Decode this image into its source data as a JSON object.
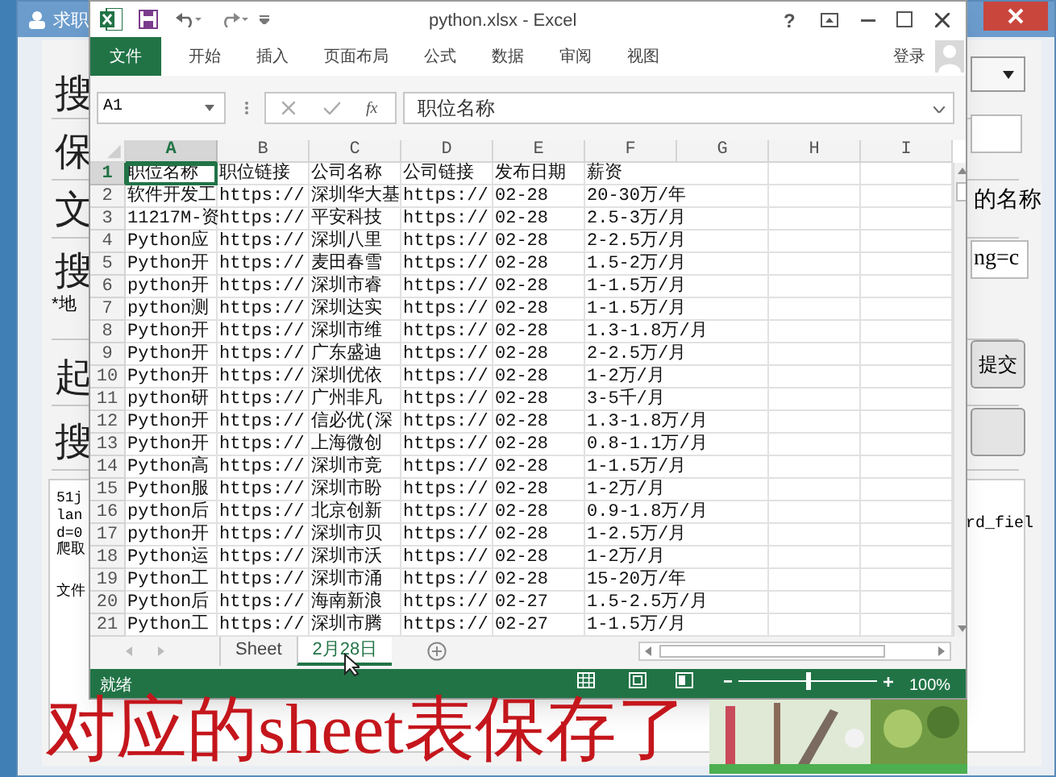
{
  "background_window": {
    "title": "求职",
    "labels": [
      "搜",
      "保",
      "文",
      "搜",
      "起",
      "搜"
    ],
    "note": "*地",
    "name_fragment": "的名称",
    "url_field": {
      "value": "ng=c"
    },
    "submit_button": "提交",
    "log_left": [
      "51j",
      "lan",
      "d=0",
      "爬取",
      "文件"
    ],
    "log_right": "rd_fiel"
  },
  "excel": {
    "title": "python.xlsx - Excel",
    "help": "?",
    "ribbon_tabs": [
      {
        "label": "文件",
        "kind": "file"
      },
      {
        "label": "开始",
        "kind": "tab"
      },
      {
        "label": "插入",
        "kind": "tab"
      },
      {
        "label": "页面布局",
        "kind": "tab"
      },
      {
        "label": "公式",
        "kind": "tab"
      },
      {
        "label": "数据",
        "kind": "tab"
      },
      {
        "label": "审阅",
        "kind": "tab"
      },
      {
        "label": "视图",
        "kind": "tab"
      }
    ],
    "sign_in": "登录",
    "name_box": "A1",
    "function_label": "fx",
    "formula": "职位名称",
    "columns": [
      {
        "label": "A",
        "selected": true
      },
      {
        "label": "B",
        "selected": false
      },
      {
        "label": "C",
        "selected": false
      },
      {
        "label": "D",
        "selected": false
      },
      {
        "label": "E",
        "selected": false
      },
      {
        "label": "F",
        "selected": false
      },
      {
        "label": "G",
        "selected": false
      },
      {
        "label": "H",
        "selected": false
      },
      {
        "label": "I",
        "selected": false
      }
    ],
    "rows": [
      {
        "number": "1",
        "selected": true,
        "cells": [
          "职位名称",
          "职位链接",
          "公司名称",
          "公司链接",
          "发布日期",
          "薪资"
        ]
      },
      {
        "number": "2",
        "selected": false,
        "cells": [
          "软件开发工",
          "https://",
          "深圳华大基",
          "https://",
          "02-28",
          "20-30万/年"
        ]
      },
      {
        "number": "3",
        "selected": false,
        "cells": [
          "11217M-资",
          "https://",
          "平安科技",
          "https://",
          "02-28",
          "2.5-3万/月"
        ]
      },
      {
        "number": "4",
        "selected": false,
        "cells": [
          "Python应",
          "https://",
          "深圳八里",
          "https://",
          "02-28",
          "2-2.5万/月"
        ]
      },
      {
        "number": "5",
        "selected": false,
        "cells": [
          "Python开",
          "https://",
          "麦田春雪",
          "https://",
          "02-28",
          "1.5-2万/月"
        ]
      },
      {
        "number": "6",
        "selected": false,
        "cells": [
          "python开",
          "https://",
          "深圳市睿",
          "https://",
          "02-28",
          "1-1.5万/月"
        ]
      },
      {
        "number": "7",
        "selected": false,
        "cells": [
          "python测",
          "https://",
          "深圳达实",
          "https://",
          "02-28",
          "1-1.5万/月"
        ]
      },
      {
        "number": "8",
        "selected": false,
        "cells": [
          "Python开",
          "https://",
          "深圳市维",
          "https://",
          "02-28",
          "1.3-1.8万/月"
        ]
      },
      {
        "number": "9",
        "selected": false,
        "cells": [
          "Python开",
          "https://",
          "广东盛迪",
          "https://",
          "02-28",
          "2-2.5万/月"
        ]
      },
      {
        "number": "10",
        "selected": false,
        "cells": [
          "Python开",
          "https://",
          "深圳优依",
          "https://",
          "02-28",
          "1-2万/月"
        ]
      },
      {
        "number": "11",
        "selected": false,
        "cells": [
          "python研",
          "https://",
          "广州非凡",
          "https://",
          "02-28",
          "3-5千/月"
        ]
      },
      {
        "number": "12",
        "selected": false,
        "cells": [
          "Python开",
          "https://",
          "信必优(深",
          "https://",
          "02-28",
          "1.3-1.8万/月"
        ]
      },
      {
        "number": "13",
        "selected": false,
        "cells": [
          "Python开",
          "https://",
          "上海微创",
          "https://",
          "02-28",
          "0.8-1.1万/月"
        ]
      },
      {
        "number": "14",
        "selected": false,
        "cells": [
          "Python高",
          "https://",
          "深圳市竞",
          "https://",
          "02-28",
          "1-1.5万/月"
        ]
      },
      {
        "number": "15",
        "selected": false,
        "cells": [
          "Python服",
          "https://",
          "深圳市盼",
          "https://",
          "02-28",
          "1-2万/月"
        ]
      },
      {
        "number": "16",
        "selected": false,
        "cells": [
          "python后",
          "https://",
          "北京创新",
          "https://",
          "02-28",
          "0.9-1.8万/月"
        ]
      },
      {
        "number": "17",
        "selected": false,
        "cells": [
          "python开",
          "https://",
          "深圳市贝",
          "https://",
          "02-28",
          "1-2.5万/月"
        ]
      },
      {
        "number": "18",
        "selected": false,
        "cells": [
          "Python运",
          "https://",
          "深圳市沃",
          "https://",
          "02-28",
          "1-2万/月"
        ]
      },
      {
        "number": "19",
        "selected": false,
        "cells": [
          "Python工",
          "https://",
          "深圳市涌",
          "https://",
          "02-28",
          "15-20万/年"
        ]
      },
      {
        "number": "20",
        "selected": false,
        "cells": [
          "Python后",
          "https://",
          "海南新浪",
          "https://",
          "02-27",
          "1.5-2.5万/月"
        ]
      },
      {
        "number": "21",
        "selected": false,
        "cells": [
          "Python工",
          "https://",
          "深圳市腾",
          "https://",
          "02-27",
          "1-1.5万/月"
        ]
      }
    ],
    "sheet_tabs": [
      {
        "label": "Sheet",
        "selected": false
      },
      {
        "label": "2月28日",
        "selected": true
      }
    ],
    "status": "就绪",
    "zoom": {
      "level": 0.5,
      "reading": "100%"
    }
  },
  "subtitle": "对应的sheet表保存了"
}
